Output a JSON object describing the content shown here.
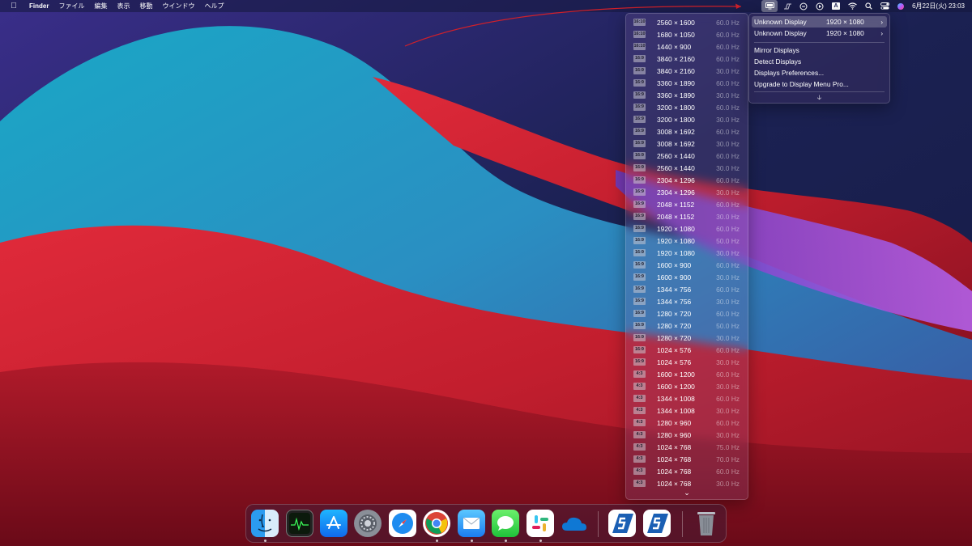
{
  "menubar": {
    "apple_icon": "apple-icon",
    "menus": [
      "Finder",
      "ファイル",
      "編集",
      "表示",
      "移動",
      "ウインドウ",
      "ヘルプ"
    ],
    "status_icons": [
      "display-menu-icon",
      "scansnap-icon",
      "screen-time-icon",
      "play-icon",
      "input-source-icon",
      "wifi-icon",
      "search-icon",
      "control-center-icon",
      "siri-icon"
    ],
    "input_source_label": "A",
    "clock": "6月22日(火)  23:03"
  },
  "resolution_menu": {
    "rows": [
      {
        "ratio": "16:10",
        "size": "2560 × 1600",
        "hz": "60.0 Hz"
      },
      {
        "ratio": "16:10",
        "size": "1680 × 1050",
        "hz": "60.0 Hz"
      },
      {
        "ratio": "16:10",
        "size": "1440 × 900",
        "hz": "60.0 Hz"
      },
      {
        "ratio": "16:9",
        "size": "3840 × 2160",
        "hz": "60.0 Hz"
      },
      {
        "ratio": "16:9",
        "size": "3840 × 2160",
        "hz": "30.0 Hz"
      },
      {
        "ratio": "16:9",
        "size": "3360 × 1890",
        "hz": "60.0 Hz"
      },
      {
        "ratio": "16:9",
        "size": "3360 × 1890",
        "hz": "30.0 Hz"
      },
      {
        "ratio": "16:9",
        "size": "3200 × 1800",
        "hz": "60.0 Hz"
      },
      {
        "ratio": "16:9",
        "size": "3200 × 1800",
        "hz": "30.0 Hz"
      },
      {
        "ratio": "16:9",
        "size": "3008 × 1692",
        "hz": "60.0 Hz"
      },
      {
        "ratio": "16:9",
        "size": "3008 × 1692",
        "hz": "30.0 Hz"
      },
      {
        "ratio": "16:9",
        "size": "2560 × 1440",
        "hz": "60.0 Hz"
      },
      {
        "ratio": "16:9",
        "size": "2560 × 1440",
        "hz": "30.0 Hz"
      },
      {
        "ratio": "16:9",
        "size": "2304 × 1296",
        "hz": "60.0 Hz"
      },
      {
        "ratio": "16:9",
        "size": "2304 × 1296",
        "hz": "30.0 Hz"
      },
      {
        "ratio": "16:9",
        "size": "2048 × 1152",
        "hz": "60.0 Hz"
      },
      {
        "ratio": "16:9",
        "size": "2048 × 1152",
        "hz": "30.0 Hz"
      },
      {
        "ratio": "16:9",
        "size": "1920 × 1080",
        "hz": "60.0 Hz"
      },
      {
        "ratio": "16:9",
        "size": "1920 × 1080",
        "hz": "50.0 Hz"
      },
      {
        "ratio": "16:9",
        "size": "1920 × 1080",
        "hz": "30.0 Hz"
      },
      {
        "ratio": "16:9",
        "size": "1600 × 900",
        "hz": "60.0 Hz"
      },
      {
        "ratio": "16:9",
        "size": "1600 × 900",
        "hz": "30.0 Hz"
      },
      {
        "ratio": "16:9",
        "size": "1344 × 756",
        "hz": "60.0 Hz"
      },
      {
        "ratio": "16:9",
        "size": "1344 × 756",
        "hz": "30.0 Hz"
      },
      {
        "ratio": "16:9",
        "size": "1280 × 720",
        "hz": "60.0 Hz"
      },
      {
        "ratio": "16:9",
        "size": "1280 × 720",
        "hz": "50.0 Hz"
      },
      {
        "ratio": "16:9",
        "size": "1280 × 720",
        "hz": "30.0 Hz"
      },
      {
        "ratio": "16:9",
        "size": "1024 × 576",
        "hz": "60.0 Hz"
      },
      {
        "ratio": "16:9",
        "size": "1024 × 576",
        "hz": "30.0 Hz"
      },
      {
        "ratio": "4:3",
        "size": "1600 × 1200",
        "hz": "60.0 Hz"
      },
      {
        "ratio": "4:3",
        "size": "1600 × 1200",
        "hz": "30.0 Hz"
      },
      {
        "ratio": "4:3",
        "size": "1344 × 1008",
        "hz": "60.0 Hz"
      },
      {
        "ratio": "4:3",
        "size": "1344 × 1008",
        "hz": "30.0 Hz"
      },
      {
        "ratio": "4:3",
        "size": "1280 × 960",
        "hz": "60.0 Hz"
      },
      {
        "ratio": "4:3",
        "size": "1280 × 960",
        "hz": "30.0 Hz"
      },
      {
        "ratio": "4:3",
        "size": "1024 × 768",
        "hz": "75.0 Hz"
      },
      {
        "ratio": "4:3",
        "size": "1024 × 768",
        "hz": "70.0 Hz"
      },
      {
        "ratio": "4:3",
        "size": "1024 × 768",
        "hz": "60.0 Hz"
      },
      {
        "ratio": "4:3",
        "size": "1024 × 768",
        "hz": "30.0 Hz"
      }
    ],
    "more_icon": "chevron-down-icon"
  },
  "display_menu": {
    "displays": [
      {
        "name": "Unknown Display",
        "resolution": "1920 × 1080",
        "highlighted": true
      },
      {
        "name": "Unknown Display",
        "resolution": "1920 × 1080",
        "highlighted": false
      }
    ],
    "submenu_arrow": "›",
    "items": [
      "Mirror Displays",
      "Detect Displays",
      "Displays Preferences...",
      "Upgrade to Display Menu Pro..."
    ],
    "footer_icon": "arrow-down-icon"
  },
  "dock": {
    "apps": [
      {
        "name": "finder",
        "running": true
      },
      {
        "name": "activity-monitor",
        "running": false
      },
      {
        "name": "app-store",
        "running": false
      },
      {
        "name": "system-preferences",
        "running": false
      },
      {
        "name": "safari",
        "running": false
      },
      {
        "name": "chrome",
        "running": true
      },
      {
        "name": "mail",
        "running": true
      },
      {
        "name": "messages",
        "running": true
      },
      {
        "name": "slack",
        "running": true
      },
      {
        "name": "onedrive",
        "running": false
      },
      {
        "name": "scansnap-home",
        "running": false
      },
      {
        "name": "scansnap-manager",
        "running": false
      },
      {
        "name": "trash",
        "running": false
      }
    ]
  },
  "colors": {
    "annotation_arrow": "#d0202a",
    "wallpaper_teal": "#1fa3c4",
    "wallpaper_red": "#c8202f",
    "wallpaper_navy": "#1b2152",
    "wallpaper_purple": "#a458e0"
  }
}
